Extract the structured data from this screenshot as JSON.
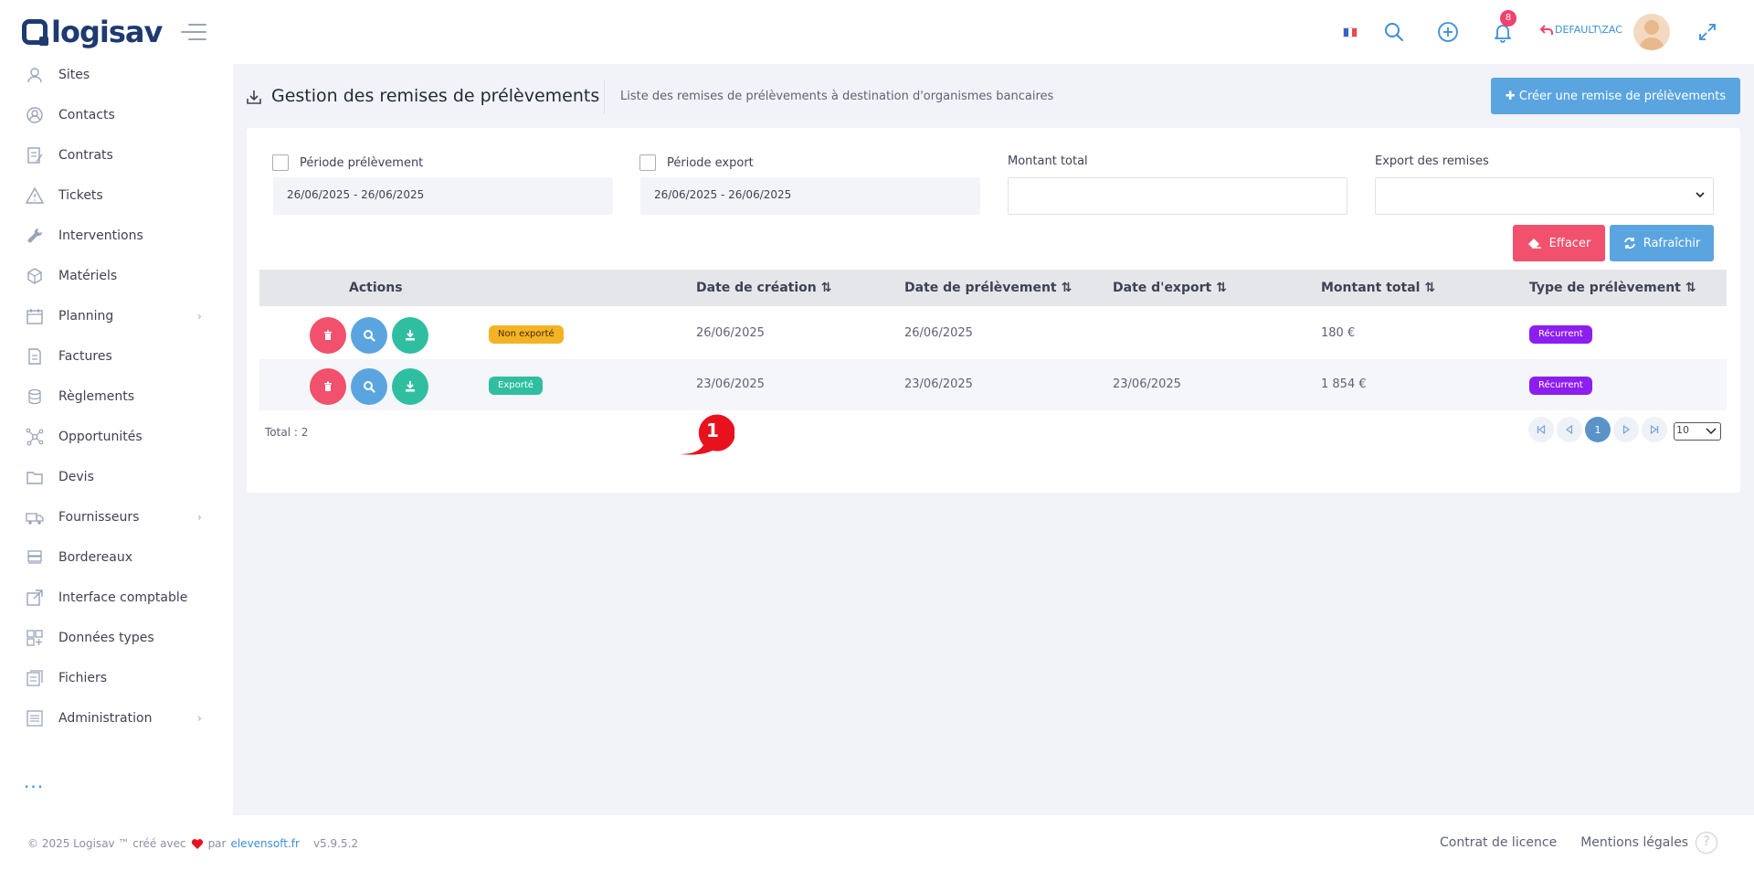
{
  "app": {
    "logo": "logisav"
  },
  "topbar": {
    "user": "DEFAULT\\ZAC",
    "notifications_count": "8",
    "flag": "fr-flag",
    "icons": [
      "search-icon",
      "plus-circle-icon",
      "bell-icon",
      "expand-icon"
    ]
  },
  "sidebar": {
    "items": [
      {
        "label": "Sites",
        "icon": "user-icon",
        "chevron": false
      },
      {
        "label": "Contacts",
        "icon": "contacts-icon",
        "chevron": false
      },
      {
        "label": "Contrats",
        "icon": "contract-icon",
        "chevron": false
      },
      {
        "label": "Tickets",
        "icon": "warning-icon",
        "chevron": false
      },
      {
        "label": "Interventions",
        "icon": "wrench-icon",
        "chevron": false
      },
      {
        "label": "Matériels",
        "icon": "box-icon",
        "chevron": false
      },
      {
        "label": "Planning",
        "icon": "calendar-icon",
        "chevron": true
      },
      {
        "label": "Factures",
        "icon": "invoice-icon",
        "chevron": false
      },
      {
        "label": "Règlements",
        "icon": "coins-icon",
        "chevron": false
      },
      {
        "label": "Opportunités",
        "icon": "network-icon",
        "chevron": false
      },
      {
        "label": "Devis",
        "icon": "folder-icon",
        "chevron": false
      },
      {
        "label": "Fournisseurs",
        "icon": "truck-icon",
        "chevron": true
      },
      {
        "label": "Bordereaux",
        "icon": "stack-icon",
        "chevron": false
      },
      {
        "label": "Interface comptable",
        "icon": "external-link-icon",
        "chevron": false
      },
      {
        "label": "Données types",
        "icon": "grid-icon",
        "chevron": false
      },
      {
        "label": "Fichiers",
        "icon": "files-icon",
        "chevron": false
      },
      {
        "label": "Administration",
        "icon": "settings-list-icon",
        "chevron": true
      }
    ],
    "more": "..."
  },
  "page": {
    "title": "Gestion des remises de prélèvements",
    "subtitle": "Liste des remises de prélèvements à destination d'organismes bancaires",
    "create_button": "Créer une remise de prélèvements"
  },
  "filters": {
    "periode_prelevement": {
      "label": "Période prélèvement",
      "value": "26/06/2025 - 26/06/2025"
    },
    "periode_export": {
      "label": "Période export",
      "value": "26/06/2025 - 26/06/2025"
    },
    "montant_total": {
      "label": "Montant total",
      "value": ""
    },
    "export_remises": {
      "label": "Export des remises",
      "value": ""
    },
    "effacer": "Effacer",
    "rafraichir": "Rafraîchir"
  },
  "table": {
    "headers": {
      "actions": "Actions",
      "date_creation": "Date de création",
      "date_prelevement": "Date de prélèvement",
      "date_export": "Date d'export",
      "montant_total": "Montant total",
      "type_prelevement": "Type de prélèvement"
    },
    "rows": [
      {
        "status": "Non exporté",
        "status_color": "#f4b325",
        "date_creation": "26/06/2025",
        "date_prelevement": "26/06/2025",
        "date_export": "",
        "montant": "180 €",
        "type": "Récurrent",
        "type_color": "#8d1ef0"
      },
      {
        "status": "Exporté",
        "status_color": "#2fbfa0",
        "date_creation": "23/06/2025",
        "date_prelevement": "23/06/2025",
        "date_export": "23/06/2025",
        "montant": "1 854 €",
        "type": "Récurrent",
        "type_color": "#8d1ef0"
      }
    ],
    "total": "Total : 2",
    "current_page": "1",
    "page_size": "10"
  },
  "annotation": {
    "marker": "1"
  },
  "footer": {
    "copyright": "© 2025 Logisav ™ créé avec",
    "par": "par",
    "company": "elevensoft.fr",
    "version": "v5.9.5.2",
    "license": "Contrat de licence",
    "legal": "Mentions légales",
    "help": "?"
  },
  "colors": {
    "primary": "#5aa5e0",
    "danger": "#f1516c",
    "success": "#2fbfa0",
    "warning": "#f4b325",
    "purple": "#8d1ef0",
    "navy": "#1e3a70"
  }
}
